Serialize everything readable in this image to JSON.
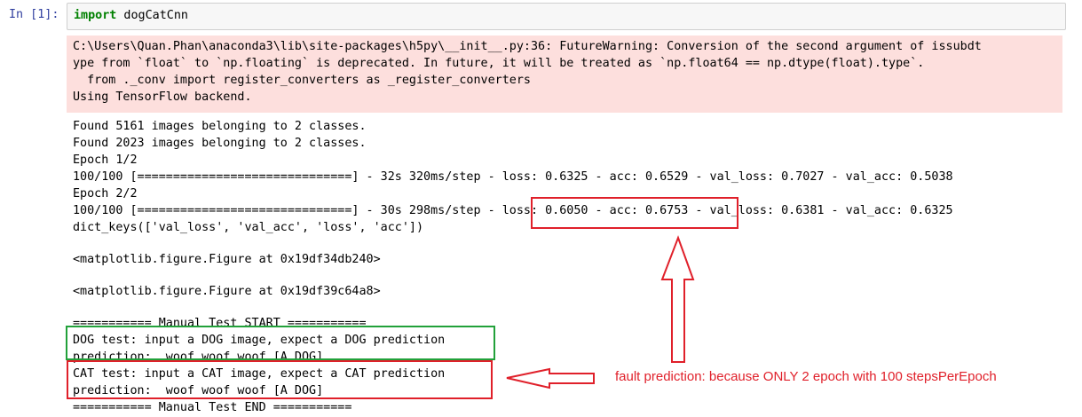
{
  "cell": {
    "prompt": "In [1]:",
    "code_keyword": "import",
    "code_rest": " dogCatCnn"
  },
  "stderr_lines": [
    "C:\\Users\\Quan.Phan\\anaconda3\\lib\\site-packages\\h5py\\__init__.py:36: FutureWarning: Conversion of the second argument of issubdt",
    "ype from `float` to `np.floating` is deprecated. In future, it will be treated as `np.float64 == np.dtype(float).type`.",
    "  from ._conv import register_converters as _register_converters",
    "Using TensorFlow backend."
  ],
  "stdout_lines": [
    "Found 5161 images belonging to 2 classes.",
    "Found 2023 images belonging to 2 classes.",
    "Epoch 1/2",
    "100/100 [==============================] - 32s 320ms/step - loss: 0.6325 - acc: 0.6529 - val_loss: 0.7027 - val_acc: 0.5038",
    "Epoch 2/2",
    "100/100 [==============================] - 30s 298ms/step - loss: 0.6050 - acc: 0.6753 - val_loss: 0.6381 - val_acc: 0.6325",
    "dict_keys(['val_loss', 'val_acc', 'loss', 'acc'])",
    "",
    "<matplotlib.figure.Figure at 0x19df34db240>",
    "",
    "<matplotlib.figure.Figure at 0x19df39c64a8>",
    "",
    "=========== Manual Test START ===========",
    "DOG test: input a DOG image, expect a DOG prediction",
    "prediction:  woof woof woof [A DOG]",
    "CAT test: input a CAT image, expect a CAT prediction",
    "prediction:  woof woof woof [A DOG]",
    "=========== Manual Test END ==========="
  ],
  "annotation": {
    "text": "fault prediction: because ONLY 2 epoch with 100 stepsPerEpoch",
    "color": "#e0202a",
    "highlight_good_color": "#22a13a"
  }
}
